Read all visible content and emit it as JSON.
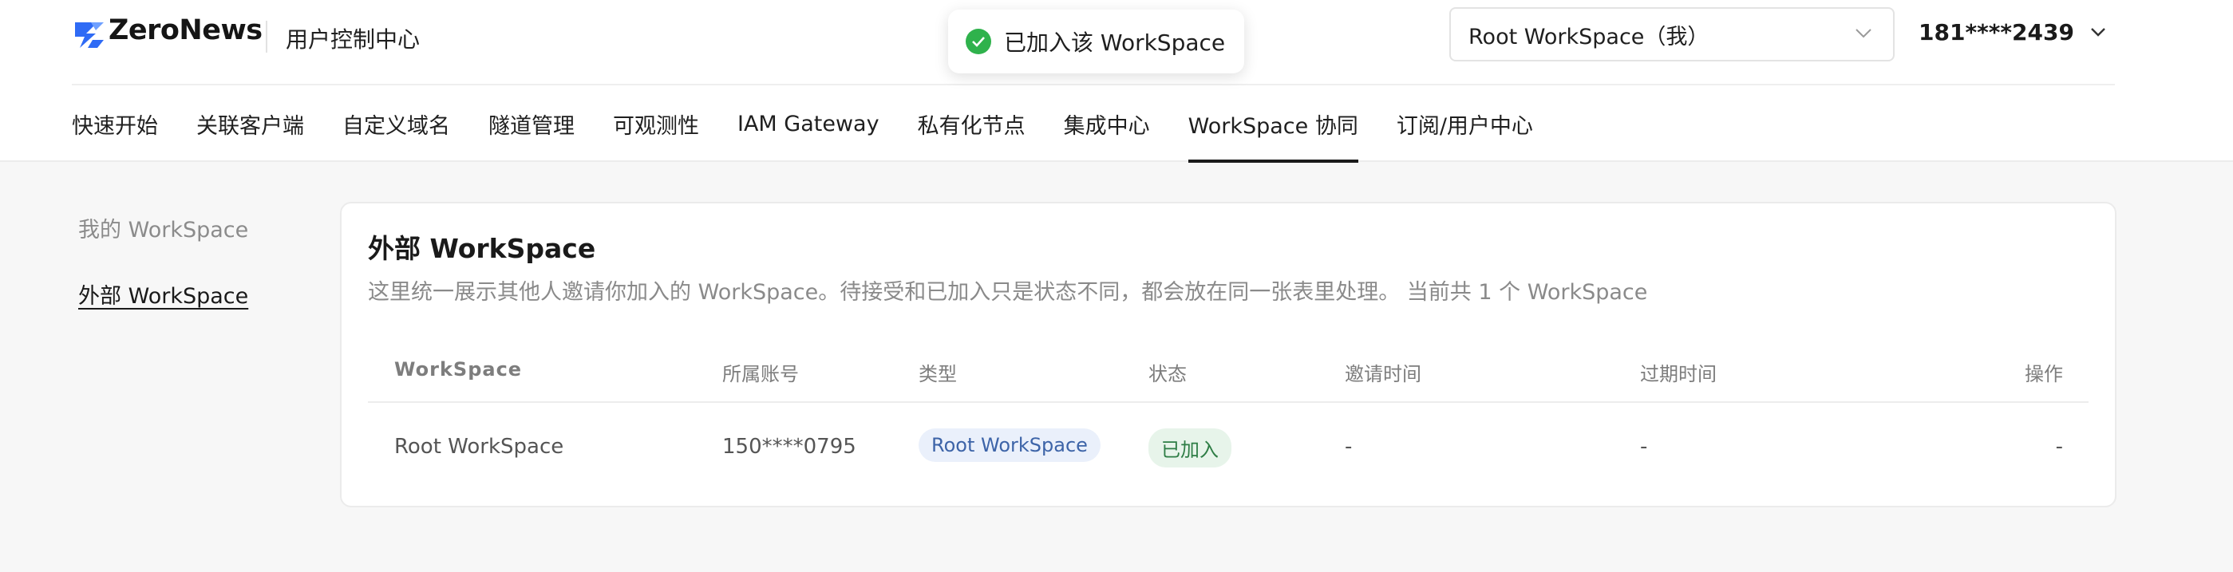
{
  "header": {
    "brand_name": "ZeroNews",
    "brand_subtitle": "用户控制中心",
    "toast_message": "已加入该 WorkSpace",
    "workspace_select_value": "Root WorkSpace（我）",
    "user_account": "181****2439"
  },
  "nav": {
    "items": [
      {
        "label": "快速开始"
      },
      {
        "label": "关联客户端"
      },
      {
        "label": "自定义域名"
      },
      {
        "label": "隧道管理"
      },
      {
        "label": "可观测性"
      },
      {
        "label": "IAM Gateway"
      },
      {
        "label": "私有化节点"
      },
      {
        "label": "集成中心"
      },
      {
        "label": "WorkSpace 协同"
      },
      {
        "label": "订阅/用户中心"
      }
    ],
    "active": "WorkSpace 协同"
  },
  "side_menu": {
    "items": [
      {
        "label": "我的 WorkSpace"
      },
      {
        "label": "外部 WorkSpace"
      }
    ],
    "active": "外部 WorkSpace"
  },
  "card": {
    "title": "外部 WorkSpace",
    "description": "这里统一展示其他人邀请你加入的 WorkSpace。待接受和已加入只是状态不同，都会放在同一张表里处理。 当前共 1 个 WorkSpace"
  },
  "table": {
    "headers": [
      "WorkSpace",
      "所属账号",
      "类型",
      "状态",
      "邀请时间",
      "过期时间",
      "操作"
    ],
    "rows": [
      {
        "workspace": "Root WorkSpace",
        "account": "150****0795",
        "type": "Root WorkSpace",
        "status": "已加入",
        "invite_time": "-",
        "expire_time": "-",
        "action": "-"
      }
    ]
  },
  "colors": {
    "logo_blue": "#2f6bf5",
    "toast_success": "#2fb24c",
    "type_tag_bg": "#eaf0fb",
    "type_tag_text": "#3d64a8",
    "status_tag_bg": "#e7f4ea",
    "status_tag_text": "#2e7d45"
  },
  "icons": {
    "logo": "zeronews-logo-icon",
    "toast": "check-circle-icon",
    "dropdown": "chevron-down-icon"
  }
}
